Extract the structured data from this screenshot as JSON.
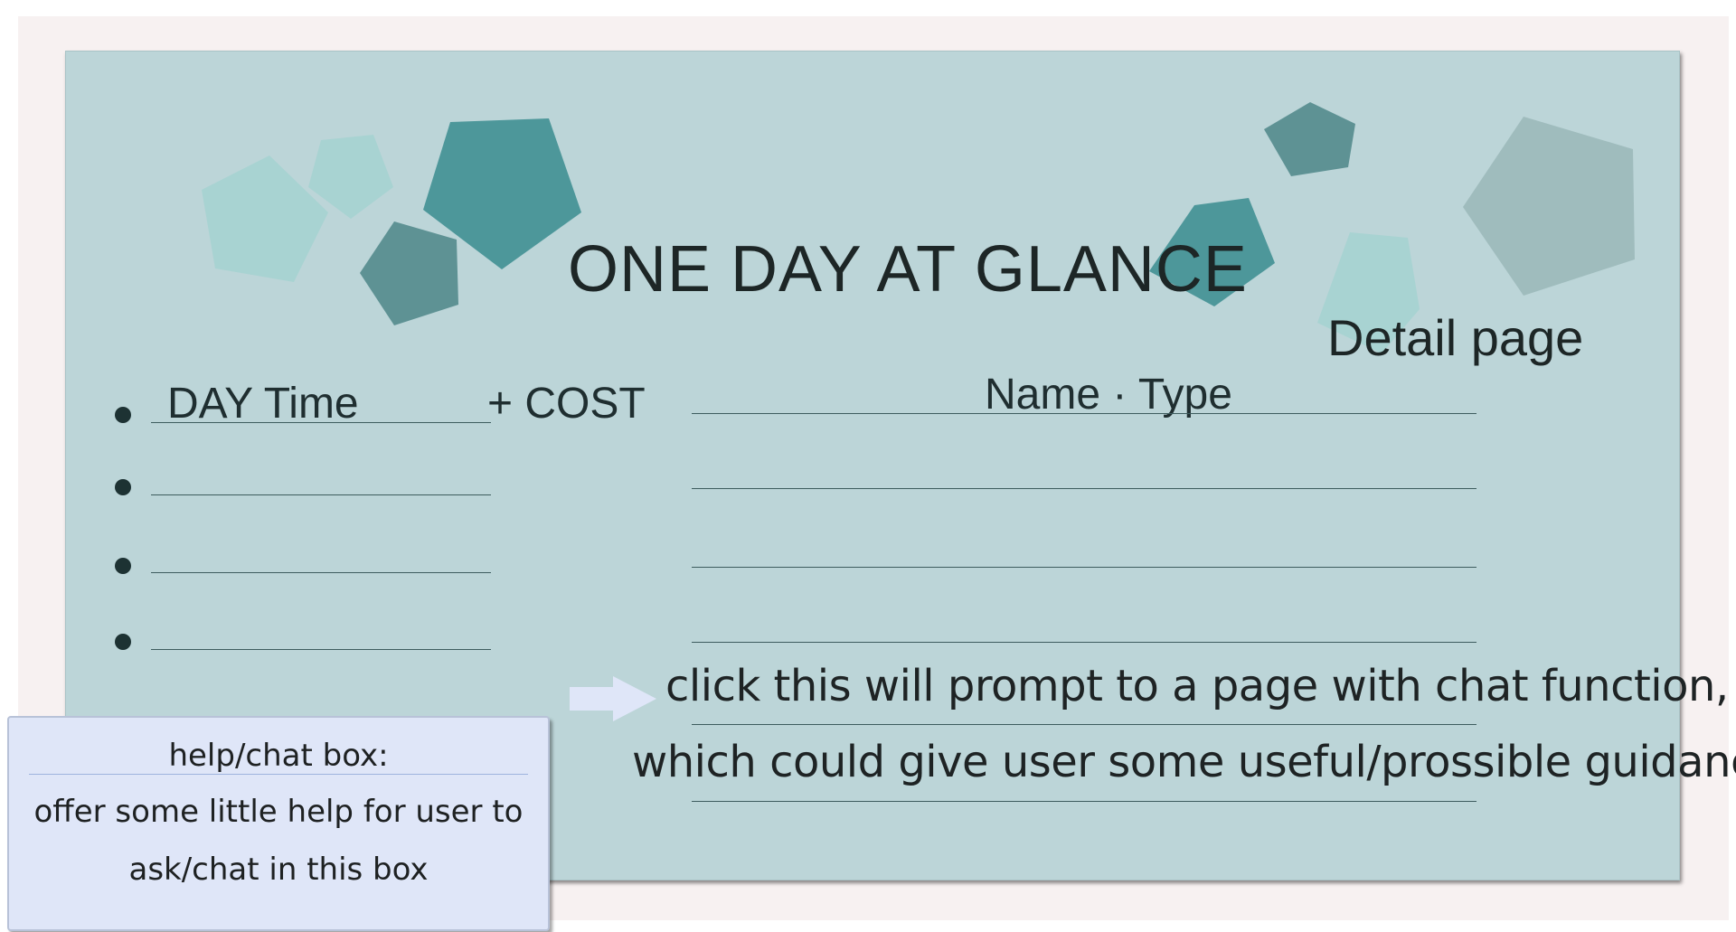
{
  "page": {
    "title": "ONE DAY AT GLANCE",
    "subtitle": "Detail page"
  },
  "list": {
    "day_time_label": "DAY Time",
    "cost_label": "+ COST",
    "name_type_label": "Name · Type"
  },
  "chat_note": {
    "line1": "click this will prompt to a page with chat function,",
    "line2": "which could give user some useful/prossible guidance"
  },
  "help_box": {
    "title": "help/chat box:",
    "line1": "offer some little help for user to",
    "line2": "ask/chat in this box"
  },
  "colors": {
    "background": "#bcd5d8",
    "pentagon_light": "#a8d3d2",
    "pentagon_teal": "#4d979a",
    "pentagon_dark": "#5e9294",
    "pentagon_grey": "#9fbcbd",
    "help_box_bg": "#dfe6f8",
    "arrow": "#dfe6f8"
  },
  "icons": {
    "arrow": "right-arrow-icon",
    "bullet": "bullet-dot-icon"
  }
}
